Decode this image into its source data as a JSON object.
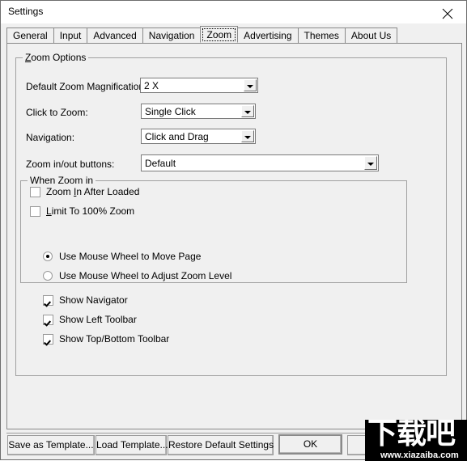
{
  "window": {
    "title": "Settings",
    "close_icon": "close-icon"
  },
  "tabs": [
    {
      "label": "General",
      "selected": false
    },
    {
      "label": "Input",
      "selected": false
    },
    {
      "label": "Advanced",
      "selected": false
    },
    {
      "label": "Navigation",
      "selected": false
    },
    {
      "label": "Zoom",
      "selected": true
    },
    {
      "label": "Advertising",
      "selected": false
    },
    {
      "label": "Themes",
      "selected": false
    },
    {
      "label": "About Us",
      "selected": false
    }
  ],
  "zoom_options": {
    "group_title_accel": "Z",
    "group_title_rest": "oom Options",
    "fields": [
      {
        "label": "Default Zoom Magnification:",
        "value": "2 X"
      },
      {
        "label": "Click to Zoom:",
        "value": "Single Click"
      },
      {
        "label": "Navigation:",
        "value": "Click and Drag"
      },
      {
        "label": "Zoom in/out buttons:",
        "value": "Default"
      }
    ],
    "checkboxes": [
      {
        "pre": "Zoom ",
        "accel": "I",
        "post": "n After Loaded",
        "checked": false
      },
      {
        "pre": "",
        "accel": "L",
        "post": "imit To 100% Zoom",
        "checked": false
      }
    ]
  },
  "when_zoom_in": {
    "group_title": "When Zoom in",
    "radios": [
      {
        "label": "Use Mouse Wheel to Move Page",
        "checked": true
      },
      {
        "label": "Use Mouse Wheel to Adjust Zoom Level",
        "checked": false
      }
    ],
    "checkboxes": [
      {
        "label": "Show Navigator",
        "checked": true
      },
      {
        "label": "Show Left Toolbar",
        "checked": true
      },
      {
        "label": "Show Top/Bottom Toolbar",
        "checked": true
      }
    ]
  },
  "footer": {
    "save_as_template": "Save as Template...",
    "load_template": "Load Template...",
    "restore_defaults": "Restore Default Settings",
    "ok": "OK",
    "cancel": ""
  },
  "watermark": {
    "cn": "下载吧",
    "url": "www.xiazaiba.com"
  },
  "colors": {
    "dialog_bg": "#f0f0f0",
    "titlebar_bg": "#ffffff",
    "border": "#898989",
    "field_bg": "#ffffff"
  }
}
